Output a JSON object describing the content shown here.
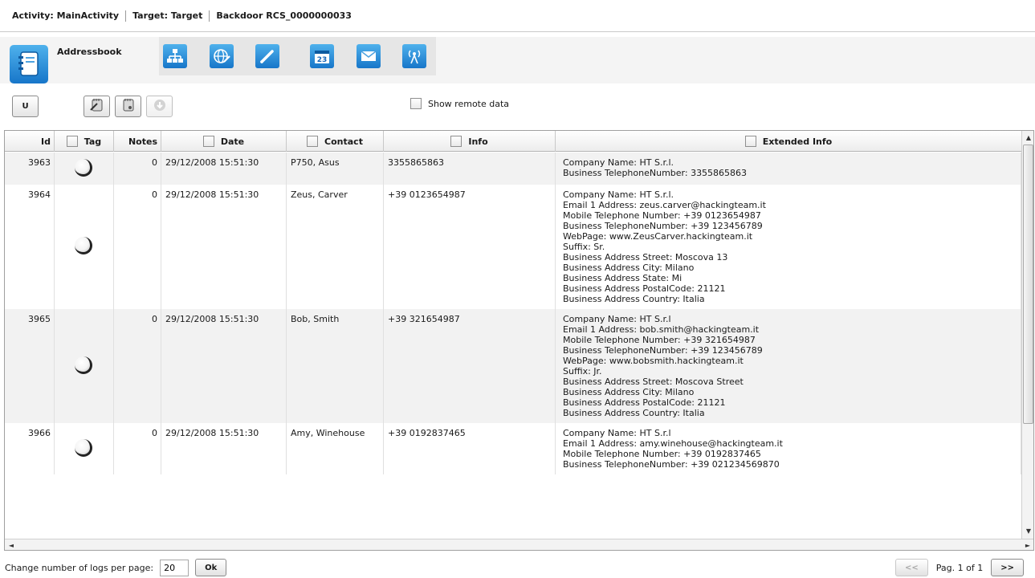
{
  "breadcrumb": {
    "activity": "Activity: MainActivity",
    "target": "Target: Target",
    "backdoor": "Backdoor RCS_0000000033"
  },
  "toolbar": {
    "active_module": "Addressbook",
    "module_icons": [
      "network-icon",
      "globe-icon",
      "pen-icon",
      "calendar-icon",
      "mail-icon",
      "antenna-icon"
    ],
    "calendar_day": "23",
    "u_button": "U",
    "show_remote_label": "Show remote data"
  },
  "table": {
    "headers": {
      "id": "Id",
      "tag": "Tag",
      "notes": "Notes",
      "date": "Date",
      "contact": "Contact",
      "info": "Info",
      "extended": "Extended Info"
    },
    "rows": [
      {
        "id": "3963",
        "notes": "0",
        "date": "29/12/2008 15:51:30",
        "contact": "P750, Asus",
        "info": "3355865863",
        "extended": [
          "Company Name: HT S.r.l.",
          "Business TelephoneNumber: 3355865863"
        ]
      },
      {
        "id": "3964",
        "notes": "0",
        "date": "29/12/2008 15:51:30",
        "contact": "Zeus, Carver",
        "info": "+39 0123654987",
        "extended": [
          "Company Name: HT S.r.l.",
          "Email 1 Address: zeus.carver@hackingteam.it",
          "Mobile Telephone Number: +39 0123654987",
          "Business TelephoneNumber: +39 123456789",
          "WebPage: www.ZeusCarver.hackingteam.it",
          "Suffix: Sr.",
          "Business Address Street: Moscova 13",
          "Business Address City: Milano",
          "Business Address State: Mi",
          "Business Address PostalCode: 21121",
          "Business Address Country: Italia"
        ]
      },
      {
        "id": "3965",
        "notes": "0",
        "date": "29/12/2008 15:51:30",
        "contact": "Bob, Smith",
        "info": "+39 321654987",
        "extended": [
          "Company Name: HT S.r.l",
          "Email 1 Address: bob.smith@hackingteam.it",
          "Mobile Telephone Number: +39 321654987",
          "Business TelephoneNumber: +39 123456789",
          "WebPage: www.bobsmith.hackingteam.it",
          "Suffix: Jr.",
          "Business Address Street: Moscova Street",
          "Business Address City: Milano",
          "Business Address PostalCode: 21121",
          "Business Address Country: Italia"
        ]
      },
      {
        "id": "3966",
        "notes": "0",
        "date": "29/12/2008 15:51:30",
        "contact": "Amy, Winehouse",
        "info": "+39 0192837465",
        "extended": [
          "Company Name: HT S.r.l",
          "Email 1 Address: amy.winehouse@hackingteam.it",
          "Mobile Telephone Number: +39 0192837465",
          "Business TelephoneNumber: +39 021234569870"
        ]
      }
    ]
  },
  "footer": {
    "per_page_label": "Change number of logs per page:",
    "per_page_value": "20",
    "ok_label": "Ok",
    "prev_label": "<<",
    "page_label": "Pag. 1 of 1",
    "next_label": ">>"
  },
  "colors": {
    "accent": "#1e86d6",
    "header_bg": "#ececec",
    "alt_row": "#f2f2f2"
  }
}
